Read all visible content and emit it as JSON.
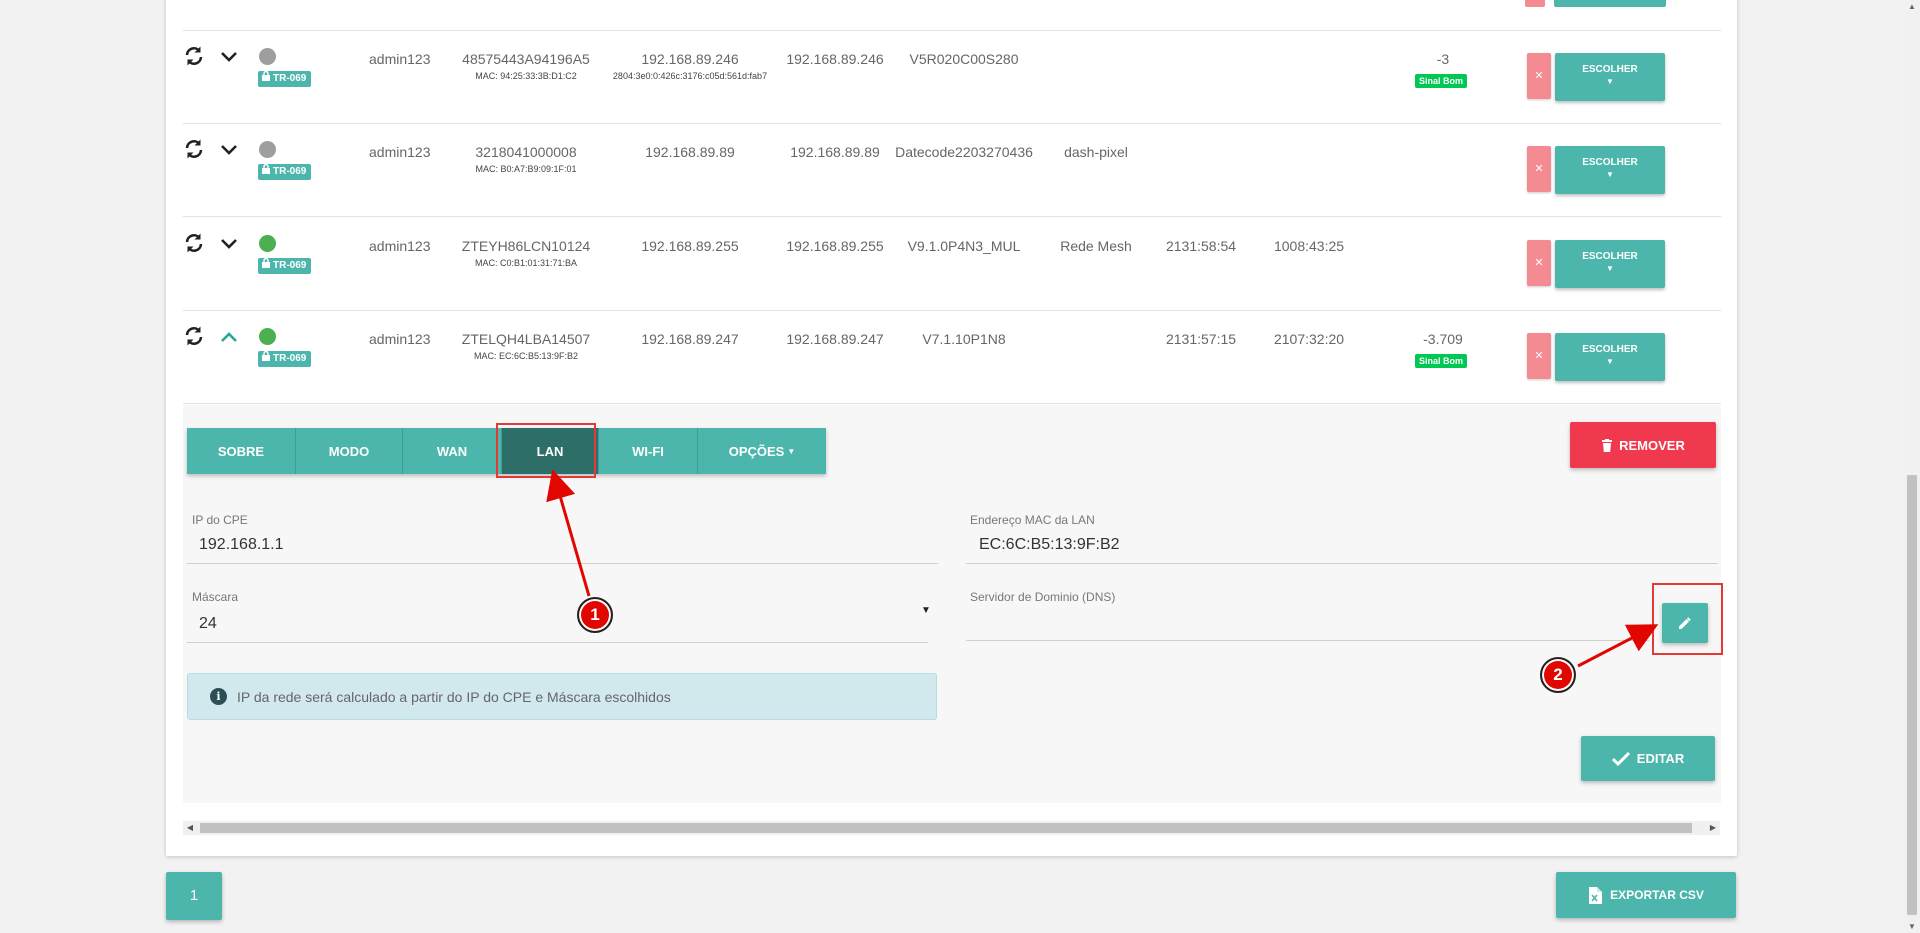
{
  "devices": [
    {
      "status": "gray",
      "expanded": false,
      "badge": "TR-069",
      "user": "admin123",
      "serial": "48575443A94196A5",
      "mac": "MAC: 94:25:33:3B:D1:C2",
      "ip1": "192.168.89.246",
      "ip2": "192.168.89.246",
      "ipv6": "2804:3e0:0:426c:3176:c05d:561d:fab7",
      "version": "V5R020C00S280",
      "mode": "",
      "uptime1": "",
      "uptime2": "",
      "signal": "-3",
      "signal_label": "Sinal Bom",
      "action": "ESCOLHER"
    },
    {
      "status": "gray",
      "expanded": false,
      "badge": "TR-069",
      "user": "admin123",
      "serial": "3218041000008",
      "mac": "MAC: B0:A7:B9:09:1F:01",
      "ip1": "192.168.89.89",
      "ip2": "192.168.89.89",
      "ipv6": "",
      "version": "Datecode2203270436",
      "mode": "dash-pixel",
      "uptime1": "",
      "uptime2": "",
      "signal": "",
      "signal_label": "",
      "action": "ESCOLHER"
    },
    {
      "status": "green",
      "expanded": false,
      "badge": "TR-069",
      "user": "admin123",
      "serial": "ZTEYH86LCN10124",
      "mac": "MAC: C0:B1:01:31:71:BA",
      "ip1": "192.168.89.255",
      "ip2": "192.168.89.255",
      "ipv6": "",
      "version": "V9.1.0P4N3_MUL",
      "mode": "Rede Mesh",
      "uptime1": "2131:58:54",
      "uptime2": "1008:43:25",
      "signal": "",
      "signal_label": "",
      "action": "ESCOLHER"
    },
    {
      "status": "green",
      "expanded": true,
      "badge": "TR-069",
      "user": "admin123",
      "serial": "ZTELQH4LBA14507",
      "mac": "MAC: EC:6C:B5:13:9F:B2",
      "ip1": "192.168.89.247",
      "ip2": "192.168.89.247",
      "ipv6": "",
      "version": "V7.1.10P1N8",
      "mode": "",
      "uptime1": "2131:57:15",
      "uptime2": "2107:32:20",
      "signal": "-3.709",
      "signal_label": "Sinal Bom",
      "action": "ESCOLHER"
    }
  ],
  "detail": {
    "tabs": [
      "SOBRE",
      "MODO",
      "WAN",
      "LAN",
      "WI-FI",
      "OPÇÕES"
    ],
    "active_tab": "LAN",
    "remove_label": "REMOVER",
    "cpe_ip_label": "IP do CPE",
    "cpe_ip_value": "192.168.1.1",
    "mask_label": "Máscara",
    "mask_value": "24",
    "mac_label": "Endereço MAC da LAN",
    "mac_value": "EC:6C:B5:13:9F:B2",
    "dns_label": "Servidor de Dominio (DNS)",
    "dns_value": "",
    "info_text": "IP da rede será calculado a partir do IP do CPE e Máscara escolhidos",
    "edit_label": "EDITAR"
  },
  "annotations": [
    "1",
    "2"
  ],
  "pagination": {
    "current": "1"
  },
  "export_label": "EXPORTAR CSV",
  "colors": {
    "primary": "#4db6ac",
    "active_tab": "#2d6e68",
    "danger": "#f0394e",
    "annotation": "#e10600",
    "signal_good": "#00c853"
  }
}
